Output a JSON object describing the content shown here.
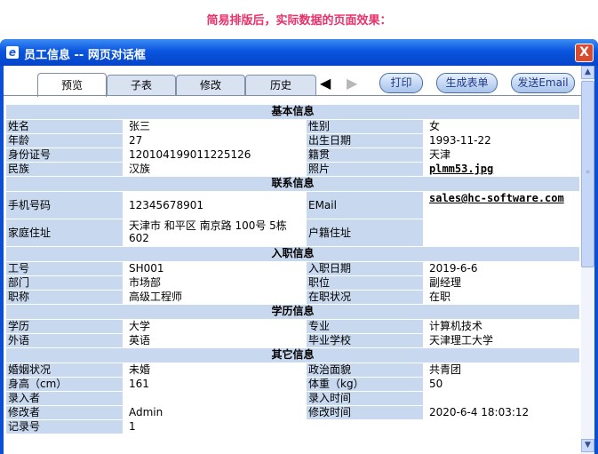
{
  "caption": "简易排版后，实际数据的页面效果：",
  "window": {
    "title": "员工信息 -- 网页对话框",
    "icon": "ie-icon",
    "close_label": "X"
  },
  "tabs": [
    {
      "label": "预览",
      "active": true
    },
    {
      "label": "子表",
      "active": false
    },
    {
      "label": "修改",
      "active": false
    },
    {
      "label": "历史",
      "active": false
    }
  ],
  "nav": {
    "prev_icon": "◀",
    "next_icon": "▶"
  },
  "buttons": {
    "print": "打印",
    "form": "生成表单",
    "email": "发送Email"
  },
  "sections": {
    "basic": "基本信息",
    "contact": "联系信息",
    "job": "入职信息",
    "edu": "学历信息",
    "other": "其它信息"
  },
  "fields": {
    "name_label": "姓名",
    "name": "张三",
    "gender_label": "性别",
    "gender": "女",
    "age_label": "年龄",
    "age": "27",
    "birth_label": "出生日期",
    "birth": "1993-11-22",
    "id_label": "身份证号",
    "id": "120104199011225126",
    "native_label": "籍贯",
    "native": "天津",
    "ethnic_label": "民族",
    "ethnic": "汉族",
    "photo_label": "照片",
    "photo": "plmm53.jpg",
    "mobile_label": "手机号码",
    "mobile": "12345678901",
    "email_label": "EMail",
    "email": "sales@hc-software.com",
    "address_label": "家庭住址",
    "address": "天津市 和平区 南京路 100号 5栋 602",
    "hukou_label": "户籍住址",
    "hukou": "",
    "empno_label": "工号",
    "empno": "SH001",
    "hire_label": "入职日期",
    "hire": "2019-6-6",
    "dept_label": "部门",
    "dept": "市场部",
    "post_label": "职位",
    "post": "副经理",
    "title_label": "职称",
    "title": "高级工程师",
    "status_label": "在职状况",
    "status": "在职",
    "degree_label": "学历",
    "degree": "大学",
    "major_label": "专业",
    "major": "计算机技术",
    "lang_label": "外语",
    "lang": "英语",
    "school_label": "毕业学校",
    "school": "天津理工大学",
    "marital_label": "婚姻状况",
    "marital": "未婚",
    "politics_label": "政治面貌",
    "politics": "共青团",
    "height_label": "身高（cm）",
    "height": "161",
    "weight_label": "体重（kg）",
    "weight": "50",
    "entry_by_label": "录入者",
    "entry_by": "",
    "entry_time_label": "录入时间",
    "entry_time": "",
    "mod_by_label": "修改者",
    "mod_by": "Admin",
    "mod_time_label": "修改时间",
    "mod_time": "2020-6-4 18:03:12",
    "record_label": "记录号",
    "record": "1"
  },
  "scrollbar": {
    "up_icon": "▲",
    "down_icon": "▼"
  }
}
